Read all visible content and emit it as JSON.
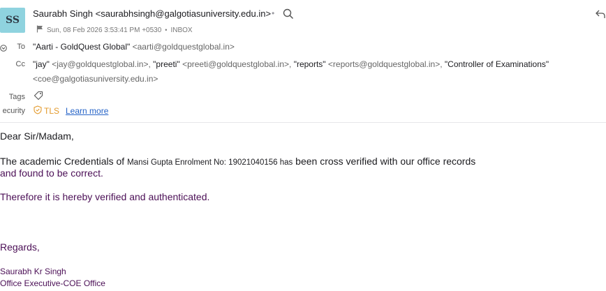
{
  "header": {
    "avatar_initials": "SS",
    "sender": "Saurabh Singh <saurabhsingh@galgotiasuniversity.edu.in>",
    "separator_dot": "•",
    "date": "Sun, 08 Feb 2026 3:53:41 PM +0530",
    "meta_dot": "•",
    "folder": "INBOX"
  },
  "recipients": {
    "to_label": "To",
    "to_name": "\"Aarti - GoldQuest Global\"",
    "to_addr": "<aarti@goldquestglobal.in>",
    "cc_label": "Cc",
    "cc_list": [
      {
        "name": "\"jay\"",
        "addr": "<jay@goldquestglobal.in>,"
      },
      {
        "name": "\"preeti\"",
        "addr": "<preeti@goldquestglobal.in>,"
      },
      {
        "name": "\"reports\"",
        "addr": "<reports@goldquestglobal.in>,"
      },
      {
        "name": "\"Controller of Examinations\"",
        "addr": ""
      }
    ],
    "cc_line2": "<coe@galgotiasuniversity.edu.in>",
    "tags_label": "Tags",
    "security_label": "ecurity",
    "security_badge": "TLS",
    "learn_more": "Learn more"
  },
  "message": {
    "greeting": "Dear Sir/Madam,",
    "p1_start": "The academic Credentials of ",
    "p1_name": "Mansi Gupta  Enrolment No: 19021040156 has",
    "p1_end": " been cross verified with our office records",
    "p1_line2": "and found to be correct.",
    "p2": "Therefore it is hereby verified and authenticated.",
    "regards": "Regards,",
    "sig_name": "Saurabh Kr Singh",
    "sig_title": "Office Executive-COE Office"
  },
  "colors": {
    "avatar_bg": "#8fd3df",
    "link": "#2563c7",
    "tls": "#e39a2c",
    "body_purple": "#4b0f56"
  },
  "icons": [
    "search-icon",
    "reply-icon",
    "flag-icon",
    "chevron-icon",
    "tag-icon",
    "shield-check-icon"
  ]
}
